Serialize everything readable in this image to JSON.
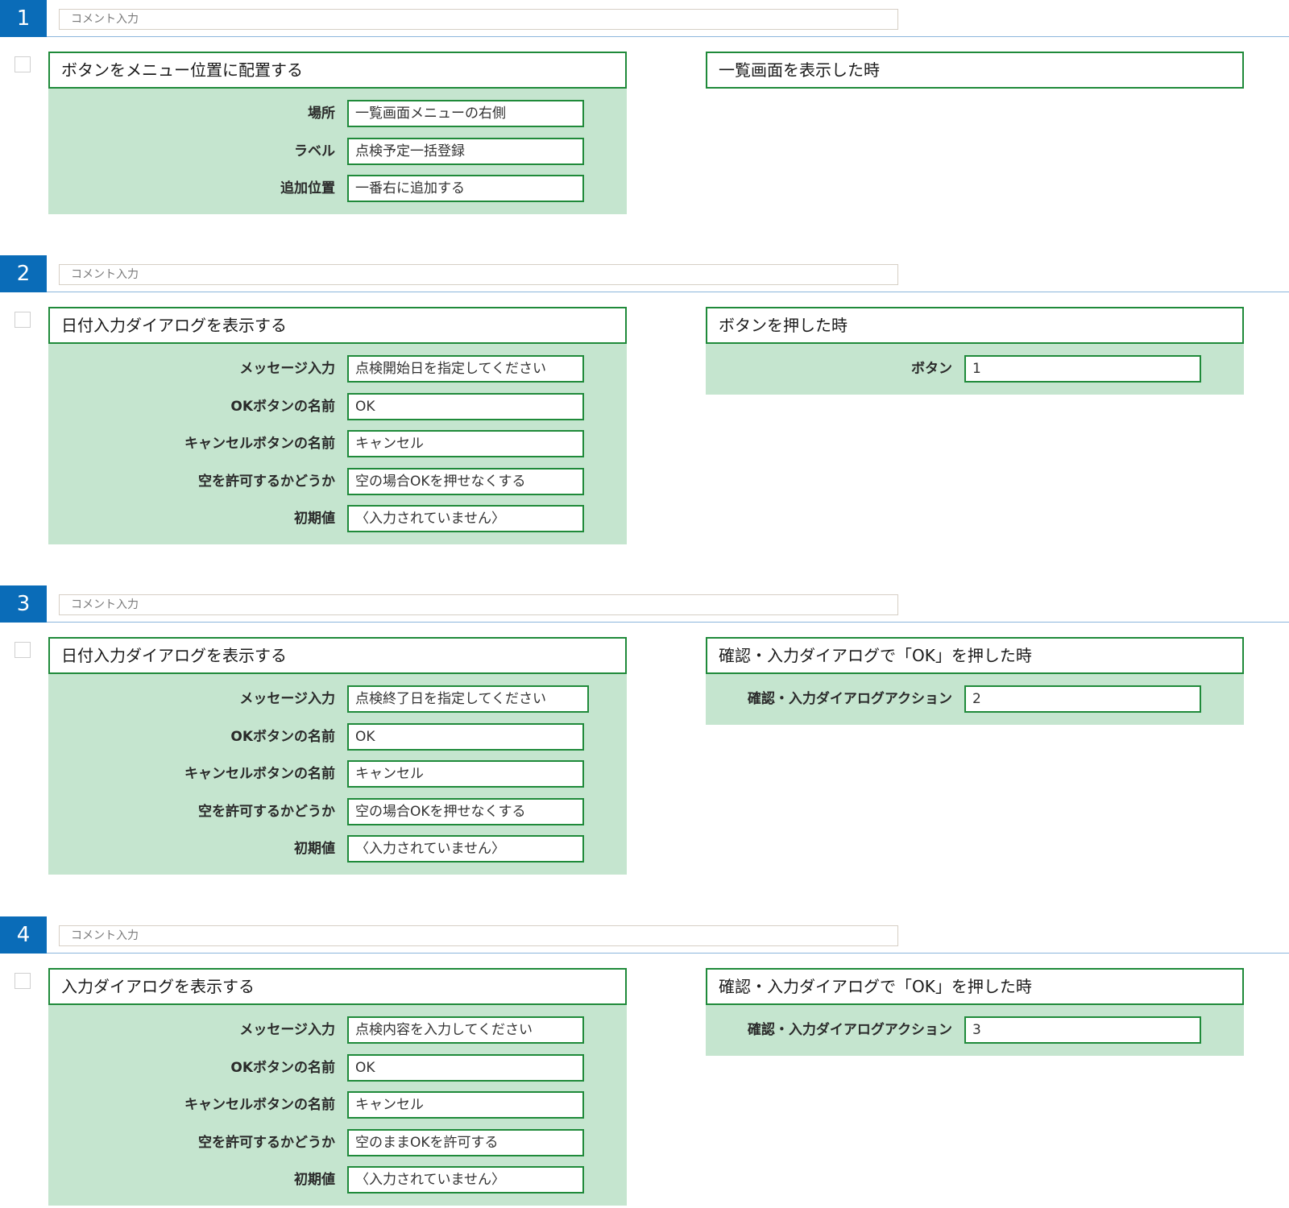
{
  "steps": [
    {
      "number": "1",
      "comment_placeholder": "コメント入力",
      "action": {
        "title": "ボタンをメニュー位置に配置する",
        "fields": [
          {
            "label": "場所",
            "value": "一覧画面メニューの右側"
          },
          {
            "label": "ラベル",
            "value": "点検予定一括登録"
          },
          {
            "label": "追加位置",
            "value": "一番右に追加する"
          }
        ]
      },
      "trigger": {
        "title": "一覧画面を表示した時",
        "fields": []
      }
    },
    {
      "number": "2",
      "comment_placeholder": "コメント入力",
      "action": {
        "title": "日付入力ダイアログを表示する",
        "fields": [
          {
            "label": "メッセージ入力",
            "value": "点検開始日を指定してください"
          },
          {
            "label": "OKボタンの名前",
            "value": "OK"
          },
          {
            "label": "キャンセルボタンの名前",
            "value": "キャンセル"
          },
          {
            "label": "空を許可するかどうか",
            "value": "空の場合OKを押せなくする"
          },
          {
            "label": "初期値",
            "value": "〈入力されていません〉"
          }
        ]
      },
      "trigger": {
        "title": "ボタンを押した時",
        "fields": [
          {
            "label": "ボタン",
            "value": "1"
          }
        ]
      }
    },
    {
      "number": "3",
      "comment_placeholder": "コメント入力",
      "action": {
        "title": "日付入力ダイアログを表示する",
        "fields": [
          {
            "label": "メッセージ入力",
            "value": "点検終了日を指定してください"
          },
          {
            "label": "OKボタンの名前",
            "value": "OK"
          },
          {
            "label": "キャンセルボタンの名前",
            "value": "キャンセル"
          },
          {
            "label": "空を許可するかどうか",
            "value": "空の場合OKを押せなくする"
          },
          {
            "label": "初期値",
            "value": "〈入力されていません〉"
          }
        ]
      },
      "trigger": {
        "title": "確認・入力ダイアログで「OK」を押した時",
        "fields": [
          {
            "label": "確認・入力ダイアログアクション",
            "value": "2"
          }
        ]
      }
    },
    {
      "number": "4",
      "comment_placeholder": "コメント入力",
      "action": {
        "title": "入力ダイアログを表示する",
        "fields": [
          {
            "label": "メッセージ入力",
            "value": "点検内容を入力してください"
          },
          {
            "label": "OKボタンの名前",
            "value": "OK"
          },
          {
            "label": "キャンセルボタンの名前",
            "value": "キャンセル"
          },
          {
            "label": "空を許可するかどうか",
            "value": "空のままOKを許可する"
          },
          {
            "label": "初期値",
            "value": "〈入力されていません〉"
          }
        ]
      },
      "trigger": {
        "title": "確認・入力ダイアログで「OK」を押した時",
        "fields": [
          {
            "label": "確認・入力ダイアログアクション",
            "value": "3"
          }
        ]
      }
    }
  ]
}
